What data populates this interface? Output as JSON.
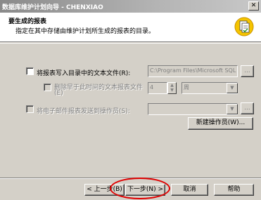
{
  "window": {
    "title": "数据库维护计划向导 - CHENXIAO",
    "close_glyph": "✕"
  },
  "header": {
    "title": "要生成的报表",
    "description": "指定在其中存储由维护计划所生成的报表的目录。",
    "icon": "report-wizard-icon"
  },
  "options": {
    "write_report": {
      "label": "将报表写入目录中的文本文件(R):",
      "checked": false,
      "path_value": "C:\\Program Files\\Microsoft SQL Se",
      "browse_label": "..."
    },
    "delete_old": {
      "label_line1": "删除早于此时间的文本报表文件",
      "label_line2": "(E)",
      "checked": false,
      "number_value": "4",
      "unit_value": "周"
    },
    "send_email": {
      "label": "将电子邮件报表发送到操作员(S):",
      "checked": false,
      "operator_value": "",
      "browse_label": "..."
    },
    "new_operator_label": "新建操作员(W)..."
  },
  "footer": {
    "back_label": "< 上一步(B)",
    "next_label": "下一步(N) >",
    "cancel_label": "取消",
    "help_label": "帮助"
  },
  "colors": {
    "face": "#d4d0c8",
    "highlight_circle": "#e00000"
  }
}
